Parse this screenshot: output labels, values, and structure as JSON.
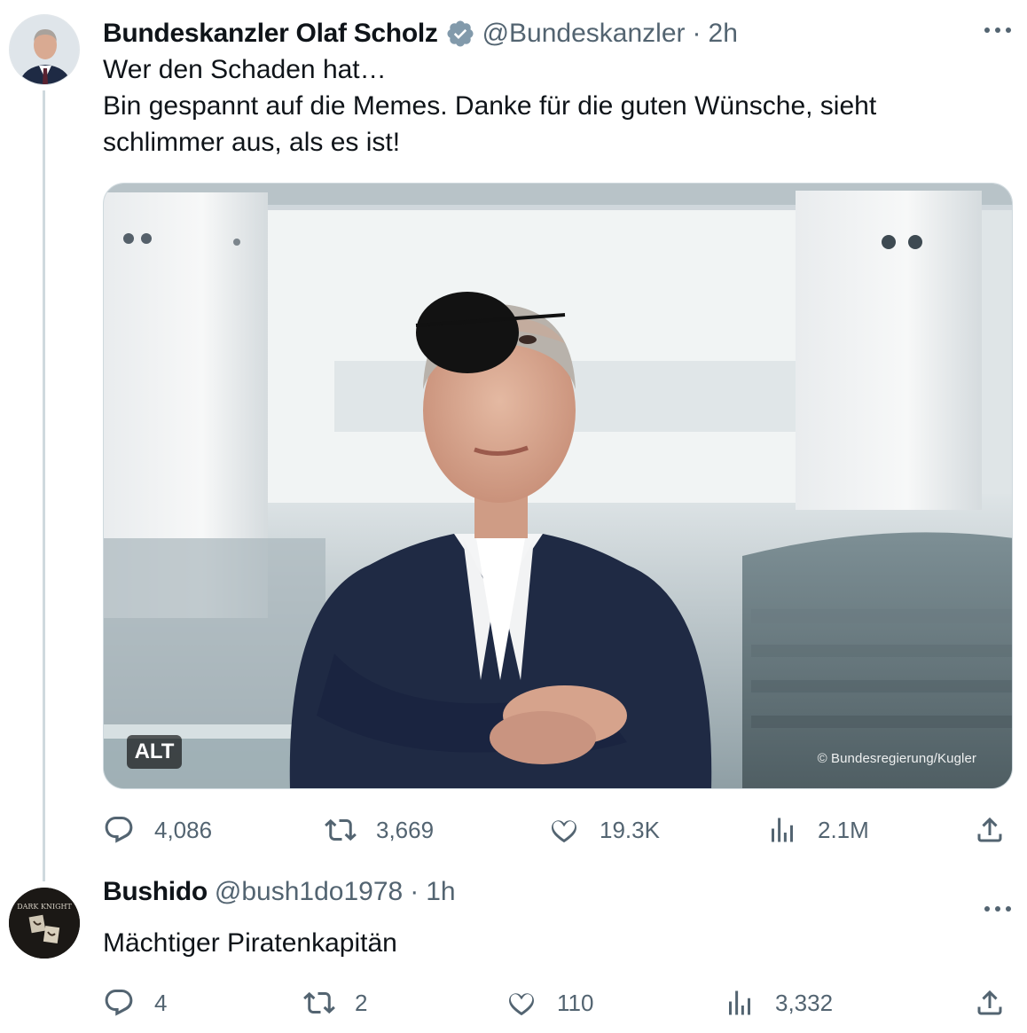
{
  "main_tweet": {
    "author": {
      "display_name": "Bundeskanzler Olaf Scholz",
      "handle": "@Bundeskanzler",
      "time": "2h",
      "verified": true
    },
    "text_lines": [
      "Wer den Schaden hat…",
      "Bin gespannt auf die Memes. Danke für die guten Wünsche, sieht",
      "schlimmer aus, als es ist!"
    ],
    "media": {
      "alt_badge": "ALT",
      "credit": "© Bundesregierung/Kugler"
    },
    "stats": {
      "replies": "4,086",
      "reposts": "3,669",
      "likes": "19.3K",
      "views": "2.1M"
    }
  },
  "reply_tweet": {
    "author": {
      "display_name": "Bushido",
      "handle": "@bush1do1978",
      "time": "1h",
      "avatar_text": "DARK KNIGHT"
    },
    "text": "Mächtiger Piratenkapitän",
    "stats": {
      "replies": "4",
      "reposts": "2",
      "likes": "110",
      "views": "3,332"
    }
  },
  "ui": {
    "separator": "·",
    "icons": [
      "verified-badge-icon",
      "more-icon",
      "reply-icon",
      "repost-icon",
      "like-icon",
      "views-icon",
      "share-icon"
    ],
    "colors": {
      "text_primary": "#0f1419",
      "text_secondary": "#536471",
      "border": "#cfd9de",
      "verified_badge": "#829aab"
    }
  }
}
